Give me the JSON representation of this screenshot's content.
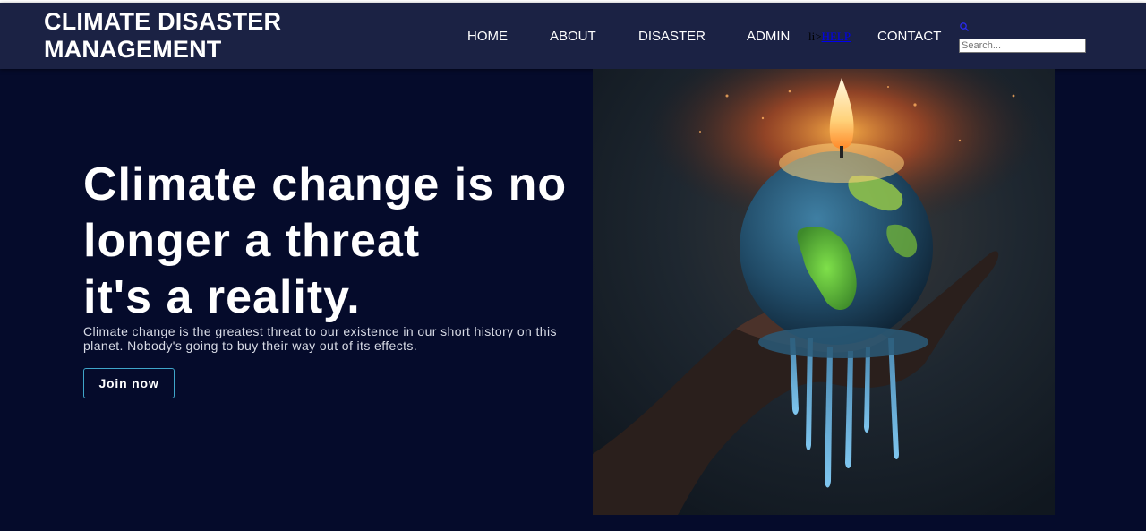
{
  "header": {
    "site_title_line1": "CLIMATE DISASTER",
    "site_title_line2": "MANAGEMENT",
    "nav": {
      "home": "HOME",
      "about": "ABOUT",
      "disaster": "DISASTER",
      "admin": "ADMIN",
      "help_prefix": "li>",
      "help": "HELP",
      "contact": "CONTACT"
    },
    "search": {
      "icon": "search-icon",
      "placeholder": "Search..."
    }
  },
  "hero": {
    "heading_line1": "Climate change is no",
    "heading_line2": "longer a threat",
    "heading_line3": "it's a reality.",
    "description": "Climate change is the greatest threat to our existence in our short history on this planet. Nobody's going to buy their way out of its effects.",
    "button_label": "Join now",
    "image": "melting-earth-candle-in-hand"
  },
  "colors": {
    "page_background": "#050b2b",
    "header_background": "#1b2244",
    "button_border": "#3fa5c9",
    "help_link": "#0000ee"
  }
}
